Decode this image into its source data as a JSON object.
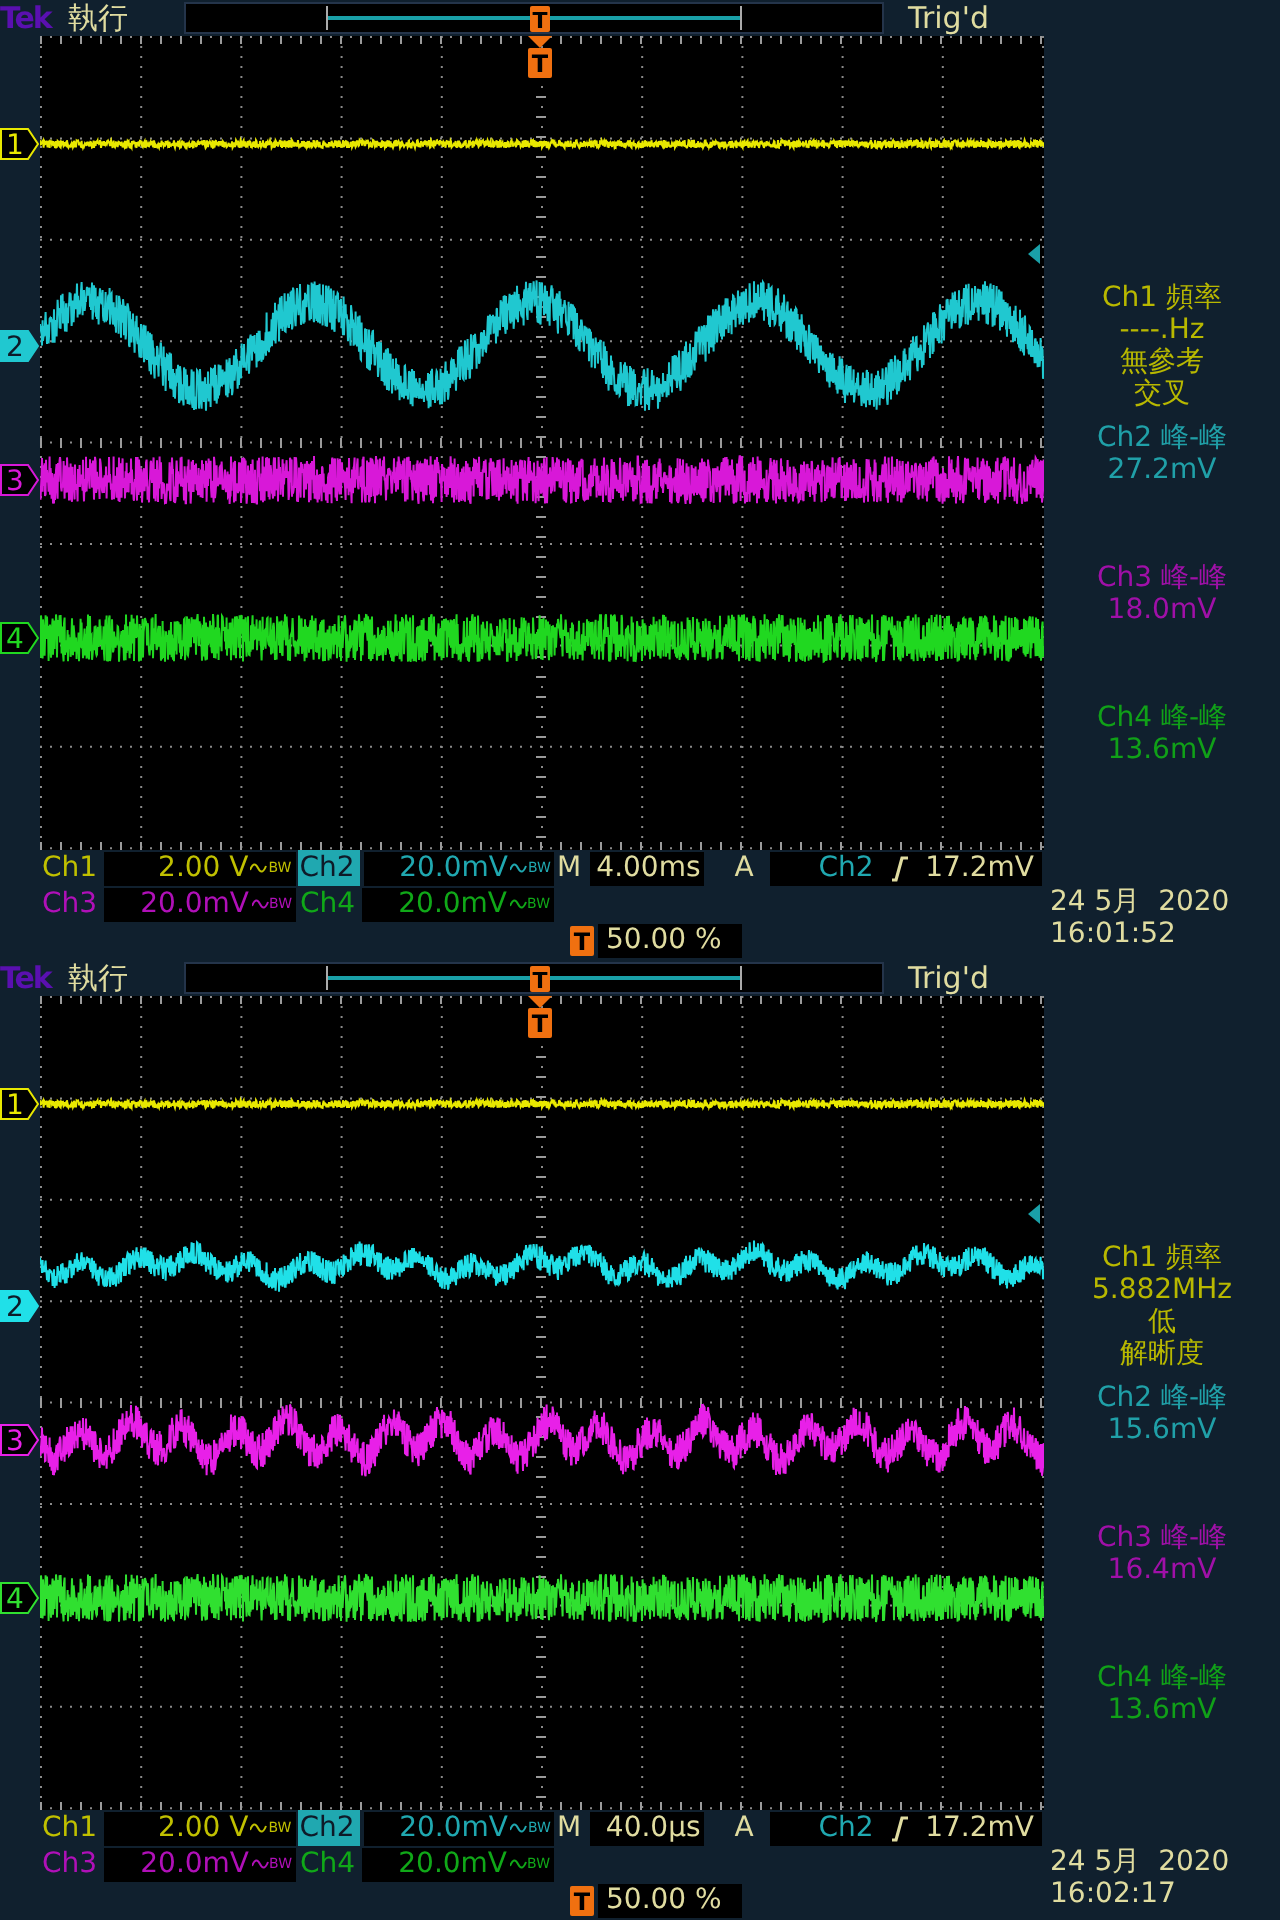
{
  "panels": [
    {
      "status": {
        "brand": "Tek",
        "run_state": "執行",
        "record_marker": "T",
        "trigger_state": "Trig'd"
      },
      "graticule": {
        "trigger_marker": "T",
        "channels": [
          {
            "label": "1",
            "color": "#e8e800",
            "kind": "flat",
            "selected": false
          },
          {
            "label": "2",
            "color": "#20c8d0",
            "kind": "sine",
            "selected": true
          },
          {
            "label": "3",
            "color": "#d818d8",
            "kind": "noise",
            "selected": false
          },
          {
            "label": "4",
            "color": "#20d820",
            "kind": "noise",
            "selected": false
          }
        ]
      },
      "measurements": [
        {
          "title": "Ch1 頻率",
          "lines": [
            "----.Hz",
            "無參考",
            "交叉"
          ],
          "color": "#b8b800"
        },
        {
          "title": "Ch2 峰-峰",
          "lines": [
            "27.2mV"
          ],
          "color": "#20a0a8"
        },
        {
          "title": "Ch3 峰-峰",
          "lines": [
            "18.0mV"
          ],
          "color": "#a010a8"
        },
        {
          "title": "Ch4 峰-峰",
          "lines": [
            "13.6mV"
          ],
          "color": "#10a018"
        }
      ],
      "readout": {
        "vertical": [
          {
            "label": "Ch1",
            "scale": "2.00 V",
            "bw": "BW",
            "color": "#c0c000",
            "selected": false
          },
          {
            "label": "Ch2",
            "scale": "20.0mV",
            "bw": "BW",
            "color": "#20a8b0",
            "selected": true
          },
          {
            "label": "Ch3",
            "scale": "20.0mV",
            "bw": "BW",
            "color": "#b010b8",
            "selected": false
          },
          {
            "label": "Ch4",
            "scale": "20.0mV",
            "bw": "BW",
            "color": "#10a818",
            "selected": false
          }
        ],
        "timebase": {
          "label": "M",
          "value": "4.00ms"
        },
        "trigger": {
          "label": "A",
          "source": "Ch2",
          "kind": "rising",
          "threshold": "17.2mV"
        },
        "position": {
          "marker": "T",
          "value": "50.00 %"
        },
        "date": "24 5月  2020",
        "time": "16:01:52"
      }
    },
    {
      "status": {
        "brand": "Tek",
        "run_state": "執行",
        "record_marker": "T",
        "trigger_state": "Trig'd"
      },
      "graticule": {
        "trigger_marker": "T",
        "channels": [
          {
            "label": "1",
            "color": "#e8e800",
            "kind": "flat",
            "selected": false
          },
          {
            "label": "2",
            "color": "#20e0e8",
            "kind": "ripple",
            "selected": true
          },
          {
            "label": "3",
            "color": "#e820e8",
            "kind": "wobble",
            "selected": false
          },
          {
            "label": "4",
            "color": "#30e030",
            "kind": "noise",
            "selected": false
          }
        ]
      },
      "measurements": [
        {
          "title": "Ch1 頻率",
          "lines": [
            "5.882MHz",
            "低",
            "解晰度"
          ],
          "color": "#b8b800"
        },
        {
          "title": "Ch2 峰-峰",
          "lines": [
            "15.6mV"
          ],
          "color": "#20a0a8"
        },
        {
          "title": "Ch3 峰-峰",
          "lines": [
            "16.4mV"
          ],
          "color": "#a010a8"
        },
        {
          "title": "Ch4 峰-峰",
          "lines": [
            "13.6mV"
          ],
          "color": "#10a018"
        }
      ],
      "readout": {
        "vertical": [
          {
            "label": "Ch1",
            "scale": "2.00 V",
            "bw": "BW",
            "color": "#c0c000",
            "selected": false
          },
          {
            "label": "Ch2",
            "scale": "20.0mV",
            "bw": "BW",
            "color": "#20a8b0",
            "selected": true
          },
          {
            "label": "Ch3",
            "scale": "20.0mV",
            "bw": "BW",
            "color": "#b010b8",
            "selected": false
          },
          {
            "label": "Ch4",
            "scale": "20.0mV",
            "bw": "BW",
            "color": "#10a818",
            "selected": false
          }
        ],
        "timebase": {
          "label": "M",
          "value": "40.0µs"
        },
        "trigger": {
          "label": "A",
          "source": "Ch2",
          "kind": "rising",
          "threshold": "17.2mV"
        },
        "position": {
          "marker": "T",
          "value": "50.00 %"
        },
        "date": "24 5月  2020",
        "time": "16:02:17"
      }
    }
  ]
}
